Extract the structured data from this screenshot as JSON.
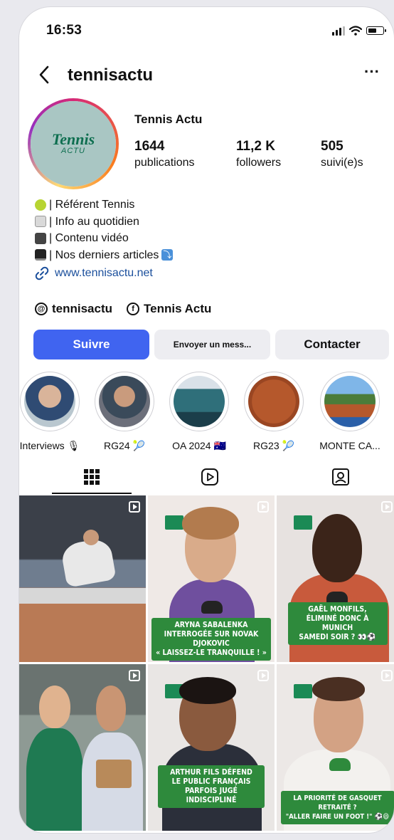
{
  "status_bar": {
    "time": "16:53"
  },
  "header": {
    "handle": "tennisactu",
    "icons": [
      "back-arrow-icon",
      "more-icon"
    ]
  },
  "profile": {
    "display_name": "Tennis Actu",
    "avatar_logo": {
      "main": "Tennis",
      "sub": "ACTU"
    },
    "stats": [
      {
        "value": "1644",
        "label": "publications"
      },
      {
        "value": "11,2 K",
        "label": "followers"
      },
      {
        "value": "505",
        "label": "suivi(e)s"
      }
    ],
    "bio": [
      {
        "icon": "tennis-ball-icon",
        "text": "| Référent Tennis"
      },
      {
        "icon": "newspaper-icon",
        "text": "| Info au quotidien"
      },
      {
        "icon": "movie-camera-icon",
        "text": "| Contenu vidéo"
      },
      {
        "icon": "laptop-icon",
        "text": "| Nos derniers articles"
      }
    ],
    "website": "www.tennisactu.net",
    "threads": "tennisactu",
    "facebook": "Tennis Actu"
  },
  "actions": {
    "follow": "Suivre",
    "message": "Envoyer un mess...",
    "contact": "Contacter"
  },
  "highlights": [
    {
      "label": "Interviews 🎙"
    },
    {
      "label": "RG24 🎾"
    },
    {
      "label": "OA 2024 🇦🇺"
    },
    {
      "label": "RG23 🎾"
    },
    {
      "label": "MONTE CA..."
    }
  ],
  "tabs": [
    "grid-icon",
    "reels-icon",
    "tagged-icon"
  ],
  "posts": [
    {
      "caption": ""
    },
    {
      "caption": "ARYNA SABALENKA\nINTERROGÉE SUR NOVAK DJOKOVIC\n« LAISSEZ-LE TRANQUILLE ! »"
    },
    {
      "caption": "GAËL MONFILS,\nÉLIMINÉ DONC À MUNICH\nSAMEDI SOIR ? 👀⚽"
    },
    {
      "caption": ""
    },
    {
      "caption": "ARTHUR FILS DÉFEND\nLE PUBLIC FRANÇAIS\nPARFOIS JUGÉ INDISCIPLINÉ"
    },
    {
      "caption": "LA PRIORITÉ DE GASQUET RETRAITÉ ?\n\"ALLER FAIRE UN FOOT !\" ⚽😄"
    }
  ],
  "colors": {
    "follow_button": "#4064f0",
    "link": "#1b4f9c",
    "caption_bg": "#2e8a3c"
  }
}
